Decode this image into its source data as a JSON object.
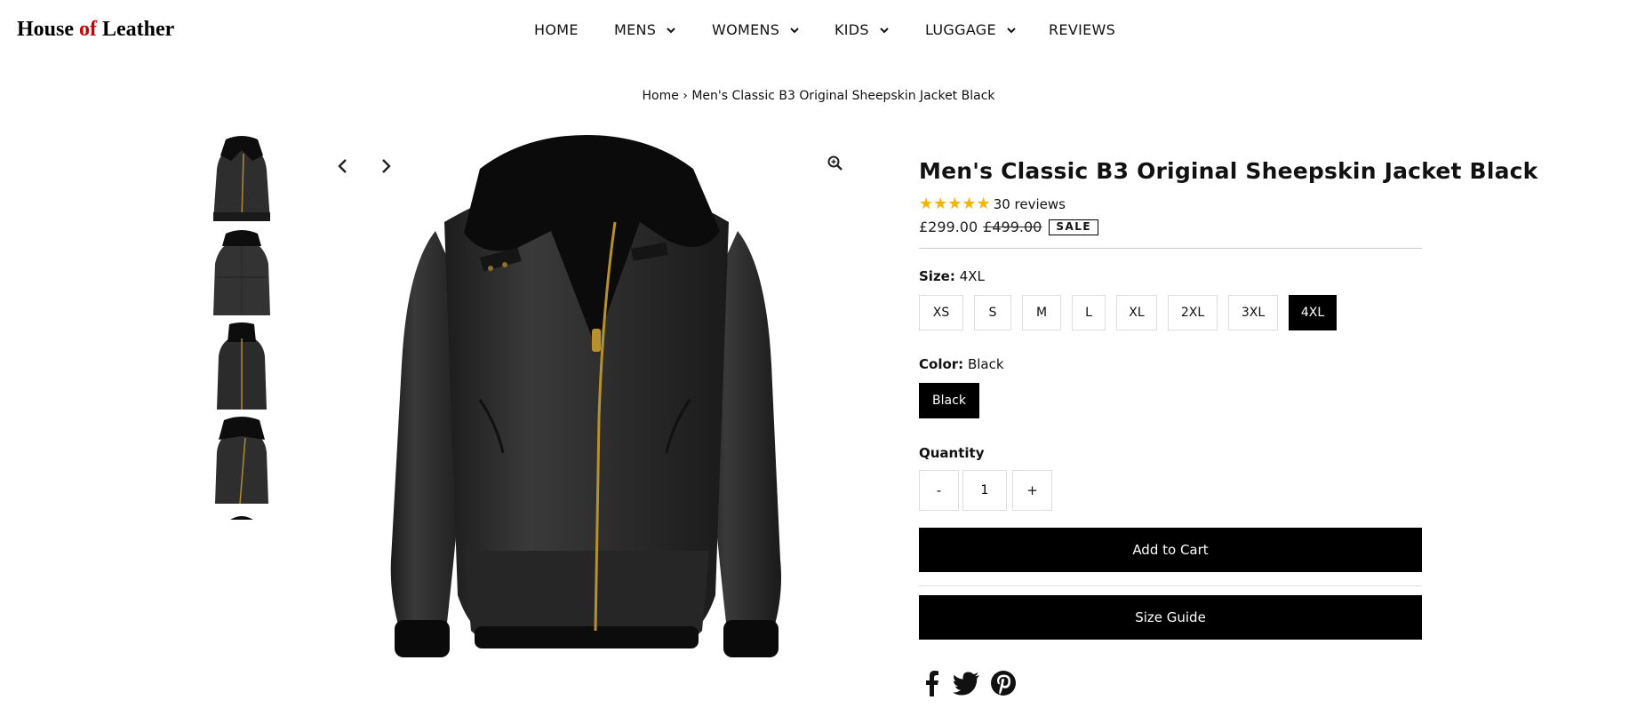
{
  "logo": {
    "part1": "House ",
    "part2": "of",
    "part3": " Leather"
  },
  "nav": {
    "home": "HOME",
    "mens": "MENS",
    "womens": "WOMENS",
    "kids": "KIDS",
    "luggage": "LUGGAGE",
    "reviews": "REVIEWS"
  },
  "breadcrumb": {
    "home": "Home",
    "separator": " › ",
    "current": "Men's Classic B3 Original Sheepskin Jacket Black"
  },
  "product": {
    "title": "Men's Classic B3 Original Sheepskin Jacket Black",
    "stars": "★★★★★",
    "rating_value": 5,
    "reviews": "30 reviews",
    "price": "£299.00",
    "old_price": "£499.00",
    "sale_badge": "SALE",
    "size_label": "Size:",
    "size_value": "4XL",
    "sizes": [
      "XS",
      "S",
      "M",
      "L",
      "XL",
      "2XL",
      "3XL",
      "4XL"
    ],
    "color_label": "Color:",
    "color_value": "Black",
    "colors": [
      "Black"
    ],
    "quantity_label": "Quantity",
    "qty_minus": "-",
    "qty_value": "1",
    "qty_plus": "+",
    "add_to_cart": "Add to Cart",
    "size_guide": "Size Guide"
  },
  "colors": {
    "accent": "#000000",
    "star": "#f5b400",
    "logo_of": "#cc0000"
  }
}
